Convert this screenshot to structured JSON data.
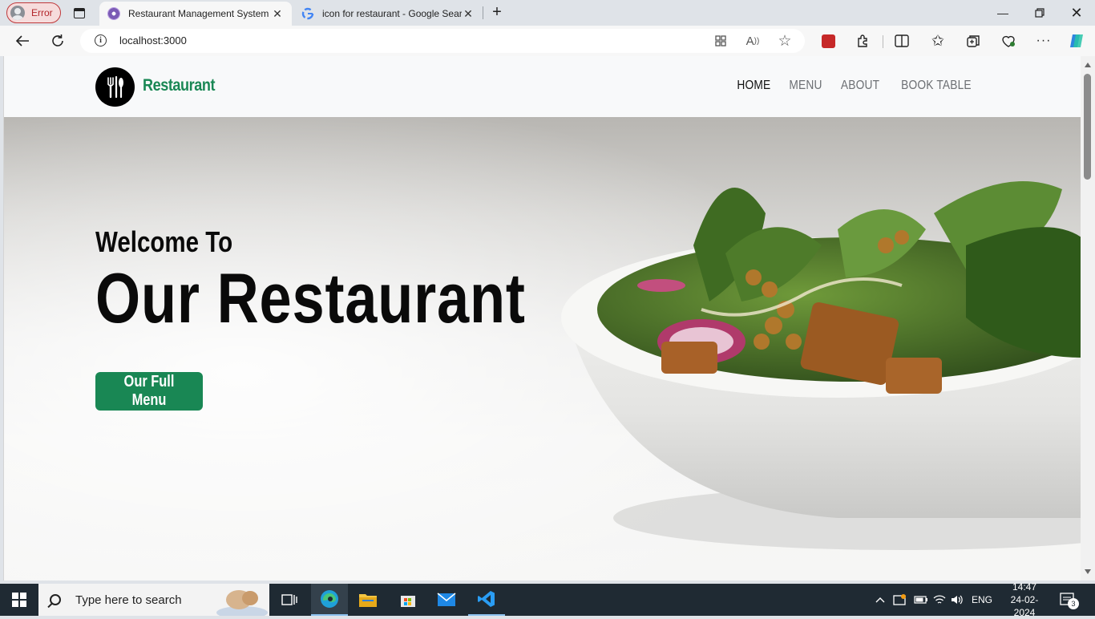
{
  "browser": {
    "profile_label": "Error",
    "tabs": [
      {
        "title": "Restaurant Management System",
        "active": true
      },
      {
        "title": "icon for restaurant - Google Search",
        "active": false
      }
    ],
    "address": "localhost:3000"
  },
  "page": {
    "brand": "Restaurant",
    "nav": [
      {
        "label": "HOME",
        "active": true
      },
      {
        "label": "MENU",
        "active": false
      },
      {
        "label": "ABOUT",
        "active": false
      },
      {
        "label": "BOOK TABLE",
        "active": false
      }
    ],
    "hero": {
      "welcome": "Welcome To",
      "headline": "Our Restaurant",
      "cta": "Our Full Menu"
    },
    "colors": {
      "accent": "#198754"
    }
  },
  "taskbar": {
    "search_placeholder": "Type here to search",
    "language": "ENG",
    "time": "14:47",
    "date": "24-02-2024",
    "notifications": "3"
  }
}
